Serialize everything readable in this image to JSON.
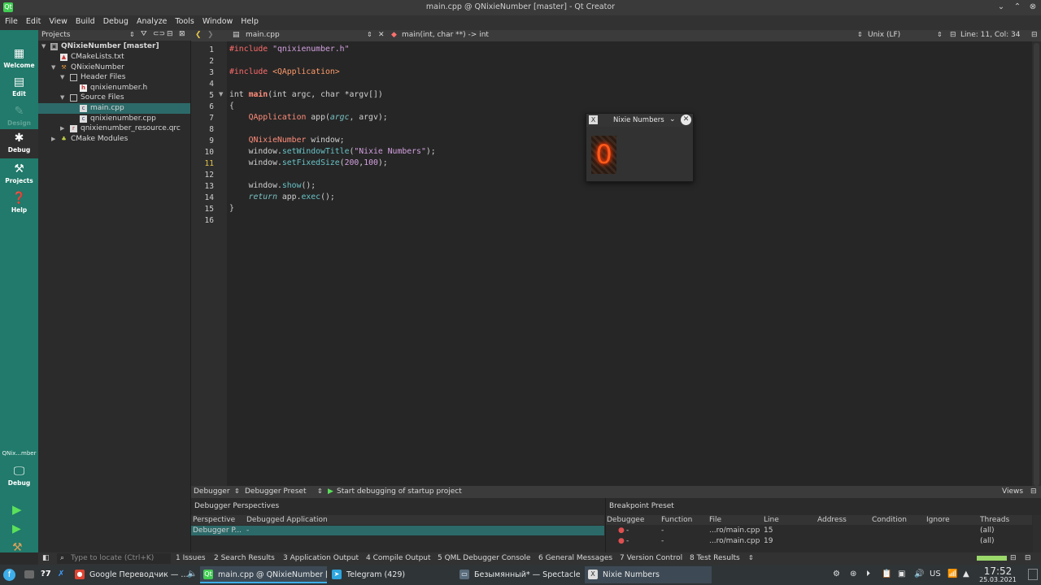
{
  "window": {
    "title": "main.cpp @ QNixieNumber [master] - Qt Creator"
  },
  "menu": [
    "File",
    "Edit",
    "View",
    "Build",
    "Debug",
    "Analyze",
    "Tools",
    "Window",
    "Help"
  ],
  "modes": [
    {
      "label": "Welcome"
    },
    {
      "label": "Edit"
    },
    {
      "label": "Design"
    },
    {
      "label": "Debug"
    },
    {
      "label": "Projects"
    },
    {
      "label": "Help"
    }
  ],
  "kit": {
    "project": "QNix...mber",
    "label": "Debug"
  },
  "projects": {
    "header": "Projects",
    "tree": [
      {
        "label": "QNixieNumber [master]"
      },
      {
        "label": "CMakeLists.txt"
      },
      {
        "label": "QNixieNumber"
      },
      {
        "label": "Header Files"
      },
      {
        "label": "qnixienumber.h"
      },
      {
        "label": "Source Files"
      },
      {
        "label": "main.cpp"
      },
      {
        "label": "qnixienumber.cpp"
      },
      {
        "label": "qnixienumber_resource.qrc"
      },
      {
        "label": "CMake Modules"
      }
    ]
  },
  "editor": {
    "file": "main.cpp",
    "symbol": "main(int, char **) -> int",
    "encoding": "Unix (LF)",
    "position": "Line: 11, Col: 34",
    "line_numbers": [
      "1",
      "2",
      "3",
      "4",
      "5",
      "6",
      "7",
      "8",
      "9",
      "10",
      "11",
      "12",
      "13",
      "14",
      "15",
      "16"
    ]
  },
  "nixie": {
    "title": "Nixie Numbers",
    "digit": "0"
  },
  "debugger": {
    "perspective_label": "Debugger",
    "preset_label": "Debugger Preset",
    "start": "Start debugging of startup project",
    "views": "Views",
    "perspectives_title": "Debugger Perspectives",
    "perspectives_cols": [
      "Perspective",
      "Debugged Application"
    ],
    "perspectives_row": [
      "Debugger P...",
      "-"
    ],
    "breakpoints_title": "Breakpoint Preset",
    "bp_cols": [
      "Debuggee",
      "Function",
      "File",
      "Line",
      "Address",
      "Condition",
      "Ignore",
      "Threads"
    ],
    "bp_rows": [
      {
        "debuggee": "-",
        "function": "-",
        "file": "...ro/main.cpp",
        "line": "15",
        "threads": "(all)"
      },
      {
        "debuggee": "-",
        "function": "-",
        "file": "...ro/main.cpp",
        "line": "19",
        "threads": "(all)"
      }
    ]
  },
  "output": {
    "locate_placeholder": "Type to locate (Ctrl+K)",
    "tabs": [
      "1  Issues",
      "2  Search Results",
      "3  Application Output",
      "4  Compile Output",
      "5  QML Debugger Console",
      "6  General Messages",
      "7  Version Control",
      "8  Test Results"
    ]
  },
  "taskbar": {
    "tasks": [
      {
        "label": "Google Переводчик — ..."
      },
      {
        "label": "main.cpp @ QNixieNumber [..."
      },
      {
        "label": "Telegram (429)"
      },
      {
        "label": "Безымянный* — Spectacle"
      },
      {
        "label": "Nixie Numbers"
      }
    ],
    "keyboard": "US",
    "time": "17:52",
    "date": "25.03.2021"
  }
}
